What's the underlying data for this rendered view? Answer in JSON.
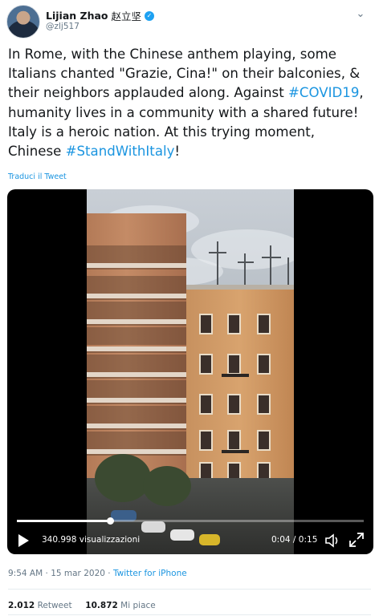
{
  "author": {
    "display_name": "Lijian Zhao",
    "cjk_name": "赵立坚",
    "handle": "@zlj517"
  },
  "tweet": {
    "text_1": "In Rome, with the Chinese anthem playing, some Italians chanted \"Grazie, Cina!\" on their balconies, & their neighbors applauded along. Against ",
    "hashtag_1": "#COVID19",
    "text_2": ", humanity lives in a community with a shared future! Italy is a heroic nation. At this trying moment, Chinese ",
    "hashtag_2": "#StandWithItaly",
    "text_3": "!",
    "translate_link": "Traduci il Tweet"
  },
  "video": {
    "views": "340.998 visualizzazioni",
    "time": "0:04 / 0:15",
    "progress": 0.27
  },
  "meta": {
    "time": "9:54 AM",
    "sep": " · ",
    "date": "15 mar 2020",
    "source": "Twitter for iPhone"
  },
  "stats": {
    "retweets_count": "2.012",
    "retweets_label": "Retweet",
    "likes_count": "10.872",
    "likes_label": "Mi piace"
  },
  "colors": {
    "accent": "#1b95e0",
    "verified": "#1da1f2"
  }
}
